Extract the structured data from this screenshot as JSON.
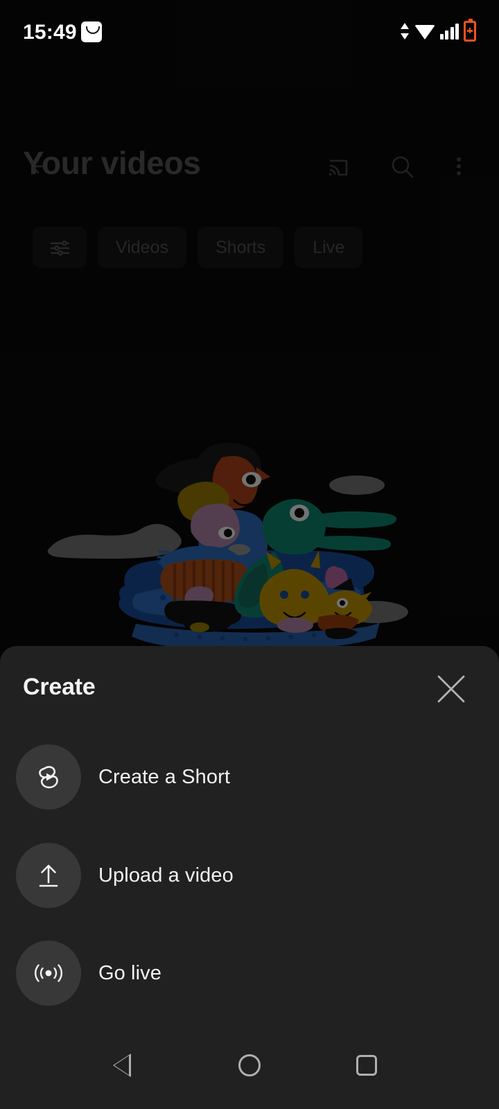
{
  "status_bar": {
    "time": "15:49",
    "notification_icon": "smiley-notification-icon",
    "data_icon": "data-transfer-icon",
    "wifi_icon": "wifi-icon",
    "signal_icon": "cellular-signal-icon",
    "battery_icon": "battery-charging-icon",
    "battery_color": "#f4511e"
  },
  "appbar": {
    "back_icon": "back-arrow-icon",
    "cast_icon": "cast-icon",
    "search_icon": "search-icon",
    "overflow_icon": "more-vertical-icon"
  },
  "page": {
    "title": "Your videos"
  },
  "chips": [
    {
      "label": "",
      "icon": "filter-sliders-icon"
    },
    {
      "label": "Videos",
      "icon": ""
    },
    {
      "label": "Shorts",
      "icon": ""
    },
    {
      "label": "Live",
      "icon": ""
    }
  ],
  "illustration": {
    "name": "people-and-pets-on-film-rug-illustration"
  },
  "sheet": {
    "title": "Create",
    "close_icon": "close-icon",
    "options": [
      {
        "label": "Create a Short",
        "icon": "shorts-icon"
      },
      {
        "label": "Upload a video",
        "icon": "upload-icon"
      },
      {
        "label": "Go live",
        "icon": "broadcast-icon"
      }
    ]
  },
  "navbar": {
    "back_icon": "nav-back-triangle-icon",
    "home_icon": "nav-home-circle-icon",
    "recents_icon": "nav-recents-square-icon"
  }
}
